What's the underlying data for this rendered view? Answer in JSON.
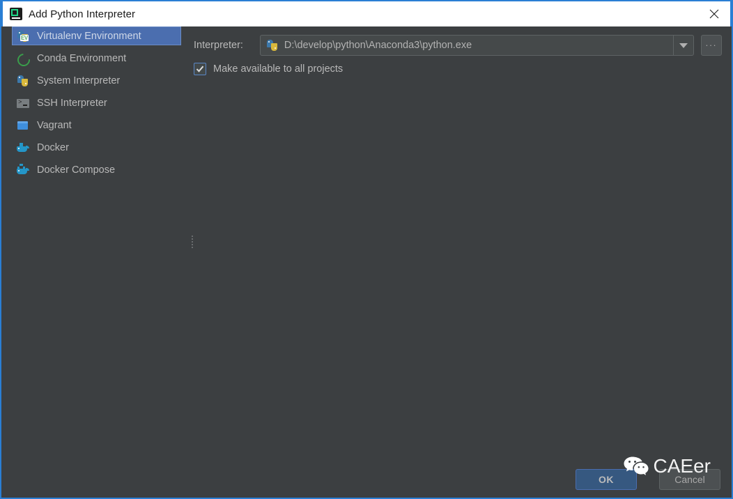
{
  "window": {
    "title": "Add Python Interpreter",
    "app_icon": "pycharm-icon",
    "close_icon": "close-icon",
    "accent_border": "#2a7fd4",
    "background": "#3c3f41"
  },
  "sidebar": {
    "items": [
      {
        "label": "Virtualenv Environment",
        "icon": "python-virtualenv-icon",
        "selected": true
      },
      {
        "label": "Conda Environment",
        "icon": "conda-icon",
        "selected": false
      },
      {
        "label": "System Interpreter",
        "icon": "python-icon",
        "selected": false
      },
      {
        "label": "SSH Interpreter",
        "icon": "terminal-icon",
        "selected": false
      },
      {
        "label": "Vagrant",
        "icon": "vagrant-cube-icon",
        "selected": false
      },
      {
        "label": "Docker",
        "icon": "docker-whale-icon",
        "selected": false
      },
      {
        "label": "Docker Compose",
        "icon": "docker-compose-icon",
        "selected": false
      }
    ],
    "selection_color": "#4b6eaf"
  },
  "main": {
    "interpreter_label": "Interpreter:",
    "interpreter_value": "D:\\develop\\python\\Anaconda3\\python.exe",
    "interpreter_icon": "python-icon",
    "dropdown_icon": "chevron-down-icon",
    "browse_button_label": "...",
    "checkbox": {
      "label": "Make available to all projects",
      "checked": true
    }
  },
  "footer": {
    "ok_label": "OK",
    "cancel_label": "Cancel",
    "ok_color": "#365880"
  },
  "watermark": {
    "text": "CAEer",
    "logo": "wechat-icon"
  }
}
